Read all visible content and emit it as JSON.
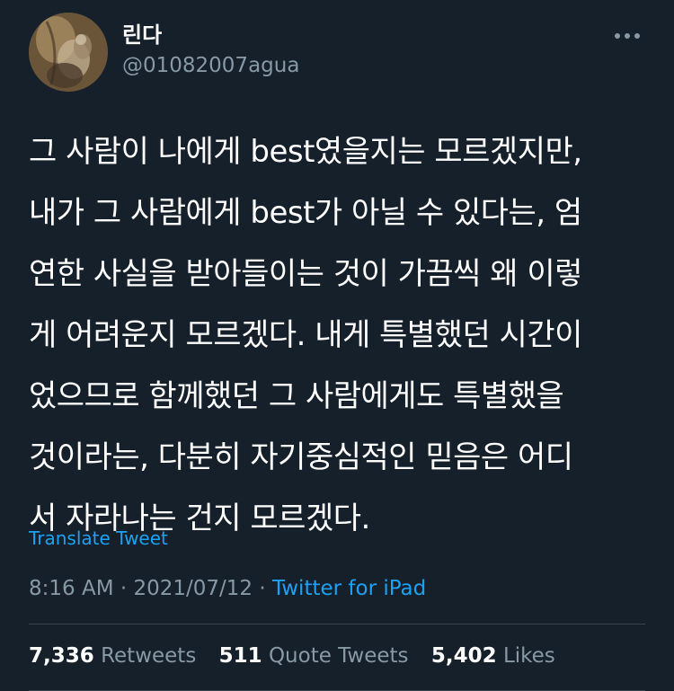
{
  "user": {
    "display_name": "린다",
    "handle": "@01082007agua"
  },
  "tweet": {
    "lines": [
      "그 사람이 나에게 best였을지는 모르겠지만,",
      "내가 그 사람에게 best가 아닐 수 있다는, 엄",
      "연한 사실을 받아들이는 것이 가끔씩 왜 이렇",
      "게 어려운지 모르겠다. 내게 특별했던 시간이",
      "었으므로 함께했던 그 사람에게도 특별했을",
      "것이라는, 다분히 자기중심적인 믿음은 어디",
      "서 자라나는 건지 모르겠다."
    ],
    "translate_label": "Translate Tweet",
    "time": "8:16 AM",
    "date": "2021/07/12",
    "separator": "·",
    "source": "Twitter for iPad"
  },
  "stats": {
    "retweets_count": "7,336",
    "retweets_label": "Retweets",
    "quote_count": "511",
    "quote_label": "Quote Tweets",
    "likes_count": "5,402",
    "likes_label": "Likes"
  },
  "icons": {
    "more": "more-horizontal-icon"
  },
  "colors": {
    "background": "#15202b",
    "accent": "#1da1f2",
    "secondary_text": "#8899a6",
    "divider": "#38444d"
  }
}
